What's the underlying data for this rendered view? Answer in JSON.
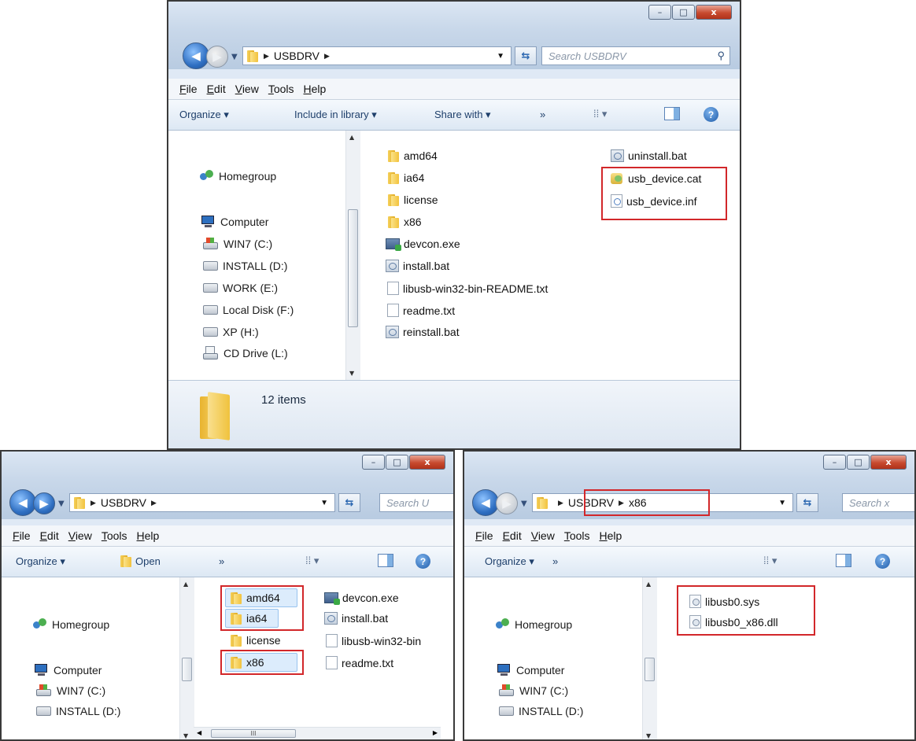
{
  "windows": {
    "top": {
      "path": [
        "USBDRV"
      ],
      "search_placeholder": "Search USBDRV",
      "menu": [
        "File",
        "Edit",
        "View",
        "Tools",
        "Help"
      ],
      "toolbar": [
        "Organize ▾",
        "Include in library ▾",
        "Share with ▾",
        "»"
      ],
      "nav": [
        "Homegroup",
        "Computer",
        "WIN7 (C:)",
        "INSTALL (D:)",
        "WORK (E:)",
        "Local Disk (F:)",
        "XP (H:)",
        "CD Drive (L:)"
      ],
      "files": [
        "amd64",
        "ia64",
        "license",
        "x86",
        "devcon.exe",
        "install.bat",
        "libusb-win32-bin-README.txt",
        "readme.txt",
        "reinstall.bat",
        "uninstall.bat",
        "usb_device.cat",
        "usb_device.inf"
      ],
      "status": "12 items"
    },
    "bottom_left": {
      "path": [
        "USBDRV"
      ],
      "search_placeholder": "Search U",
      "menu": [
        "File",
        "Edit",
        "View",
        "Tools",
        "Help"
      ],
      "toolbar": [
        "Organize ▾",
        "Open",
        "»"
      ],
      "nav": [
        "Homegroup",
        "Computer",
        "WIN7 (C:)",
        "INSTALL (D:)"
      ],
      "files": [
        "amd64",
        "ia64",
        "license",
        "x86",
        "devcon.exe",
        "install.bat",
        "libusb-win32-bin",
        "readme.txt"
      ],
      "hscroll_grip": "III"
    },
    "bottom_right": {
      "path": [
        "USBDRV",
        "x86"
      ],
      "search_placeholder": "Search x",
      "menu": [
        "File",
        "Edit",
        "View",
        "Tools",
        "Help"
      ],
      "toolbar": [
        "Organize ▾",
        "»"
      ],
      "nav": [
        "Homegroup",
        "Computer",
        "WIN7 (C:)",
        "INSTALL (D:)"
      ],
      "files": [
        "libusb0.sys",
        "libusb0_x86.dll"
      ]
    }
  },
  "window_controls": {
    "minimize": "–",
    "maximize": "□",
    "close": "x"
  },
  "colors": {
    "highlight_box": "#d2272a",
    "accent": "#2f6fc2"
  }
}
